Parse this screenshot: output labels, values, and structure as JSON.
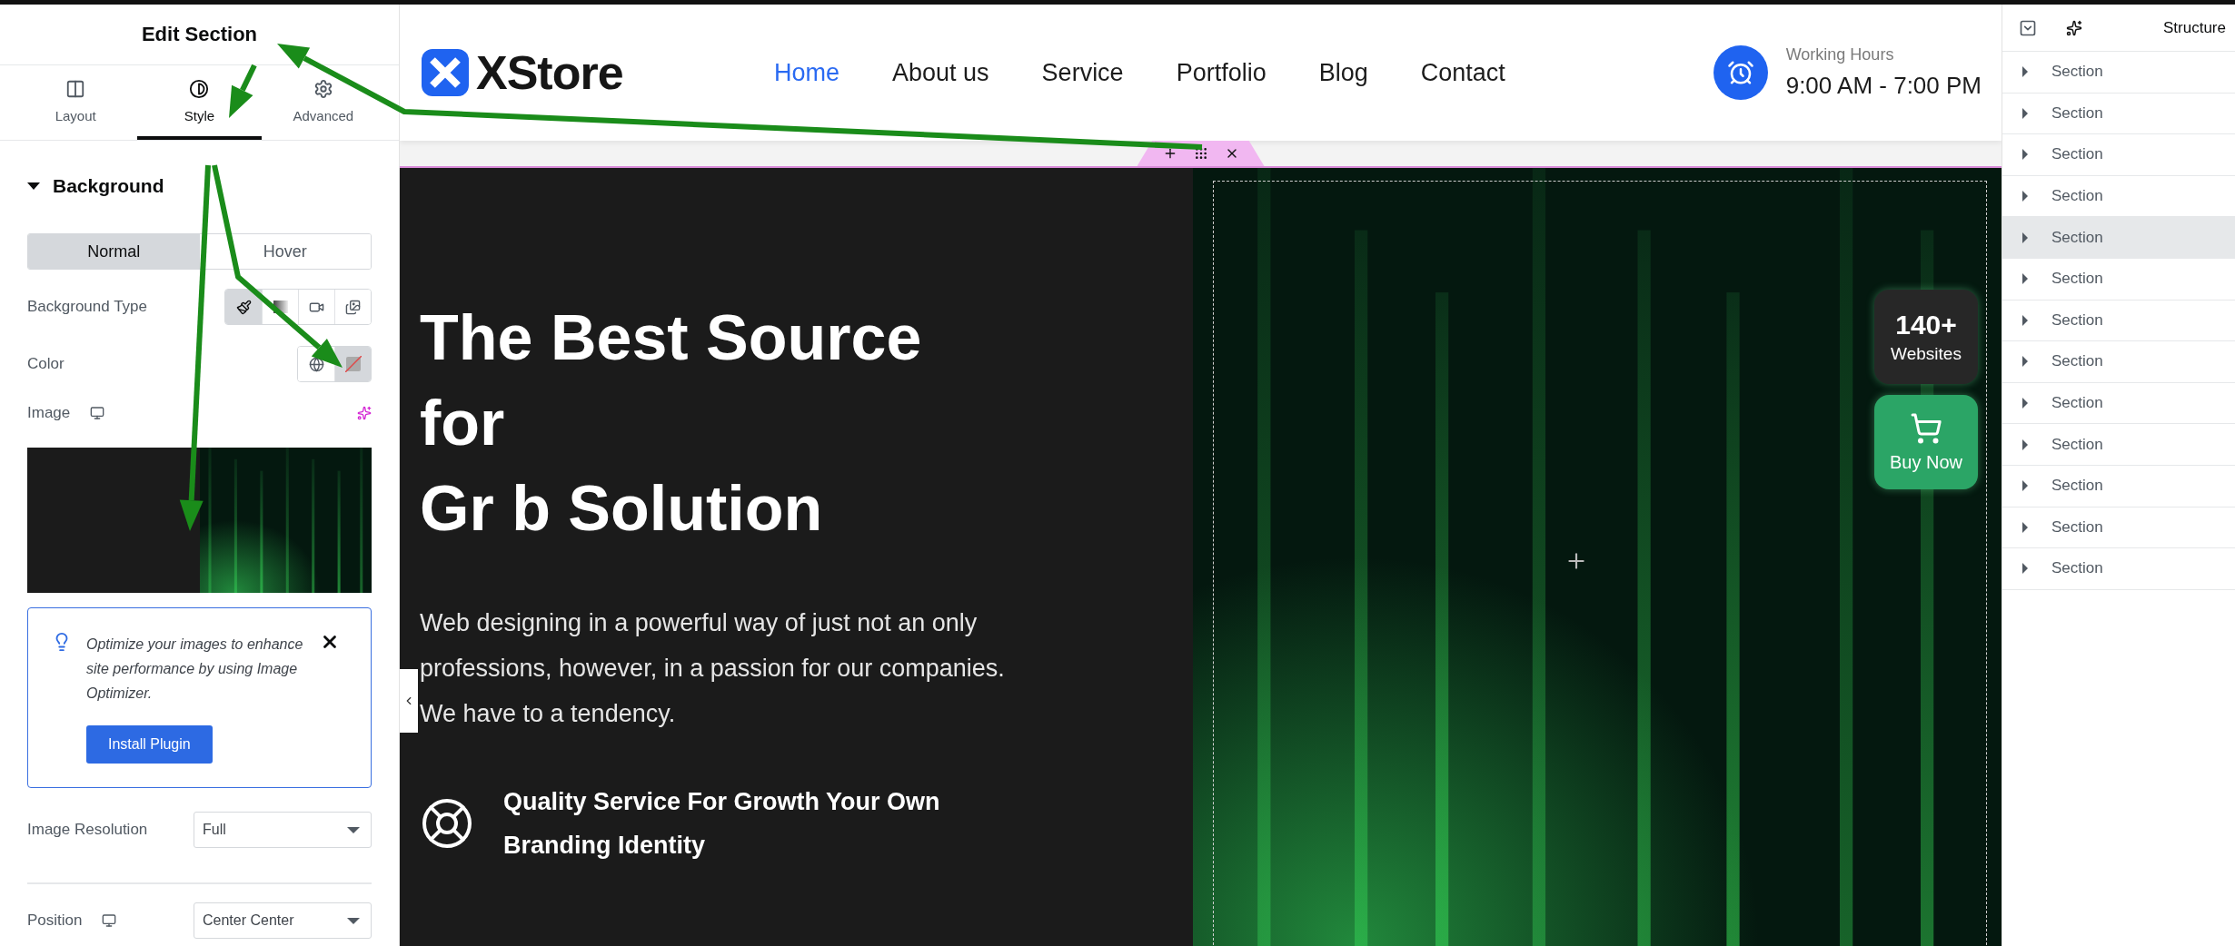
{
  "panel": {
    "title": "Edit Section",
    "tabs": [
      {
        "label": "Layout",
        "kind": "layout",
        "selected": false
      },
      {
        "label": "Style",
        "kind": "style",
        "selected": true
      },
      {
        "label": "Advanced",
        "kind": "advanced",
        "selected": false
      }
    ],
    "section": {
      "title": "Background",
      "expanded": true
    },
    "state_toggle": [
      {
        "label": "Normal",
        "selected": true
      },
      {
        "label": "Hover",
        "selected": false
      }
    ],
    "background_type": {
      "label": "Background Type",
      "options": [
        {
          "kind": "classic",
          "selected": true
        },
        {
          "kind": "gradient",
          "selected": false
        },
        {
          "kind": "video",
          "selected": false
        },
        {
          "kind": "slideshow",
          "selected": false
        }
      ]
    },
    "color": {
      "label": "Color"
    },
    "image": {
      "label": "Image"
    },
    "notice": {
      "text": "Optimize your images to enhance site performance by using Image Optimizer.",
      "button": "Install Plugin"
    },
    "image_resolution": {
      "label": "Image Resolution",
      "value": "Full"
    },
    "position": {
      "label": "Position",
      "value": "Center Center"
    }
  },
  "site": {
    "logo": "XStore",
    "nav": [
      {
        "label": "Home",
        "selected": true
      },
      {
        "label": "About us",
        "selected": false
      },
      {
        "label": "Service",
        "selected": false
      },
      {
        "label": "Portfolio",
        "selected": false
      },
      {
        "label": "Blog",
        "selected": false
      },
      {
        "label": "Contact",
        "selected": false
      }
    ],
    "hours_label": "Working Hours",
    "hours": "9:00 AM - 7:00 PM",
    "hero": {
      "heading": [
        "The Best Source",
        "for",
        "Gr b Solution"
      ],
      "text": "Web designing in a powerful way of just not an only professions, however, in a passion for our companies. We have to a tendency.",
      "feature": "Quality Service For Growth Your Own Branding Identity"
    },
    "stats": {
      "value": "140+",
      "label": "Websites"
    },
    "buy": "Buy Now"
  },
  "structure": {
    "title": "Structure",
    "items": [
      {
        "label": "Section",
        "selected": false
      },
      {
        "label": "Section",
        "selected": false
      },
      {
        "label": "Section",
        "selected": false
      },
      {
        "label": "Section",
        "selected": false
      },
      {
        "label": "Section",
        "selected": true
      },
      {
        "label": "Section",
        "selected": false
      },
      {
        "label": "Section",
        "selected": false
      },
      {
        "label": "Section",
        "selected": false
      },
      {
        "label": "Section",
        "selected": false
      },
      {
        "label": "Section",
        "selected": false
      },
      {
        "label": "Section",
        "selected": false
      },
      {
        "label": "Section",
        "selected": false
      },
      {
        "label": "Section",
        "selected": false
      }
    ]
  }
}
